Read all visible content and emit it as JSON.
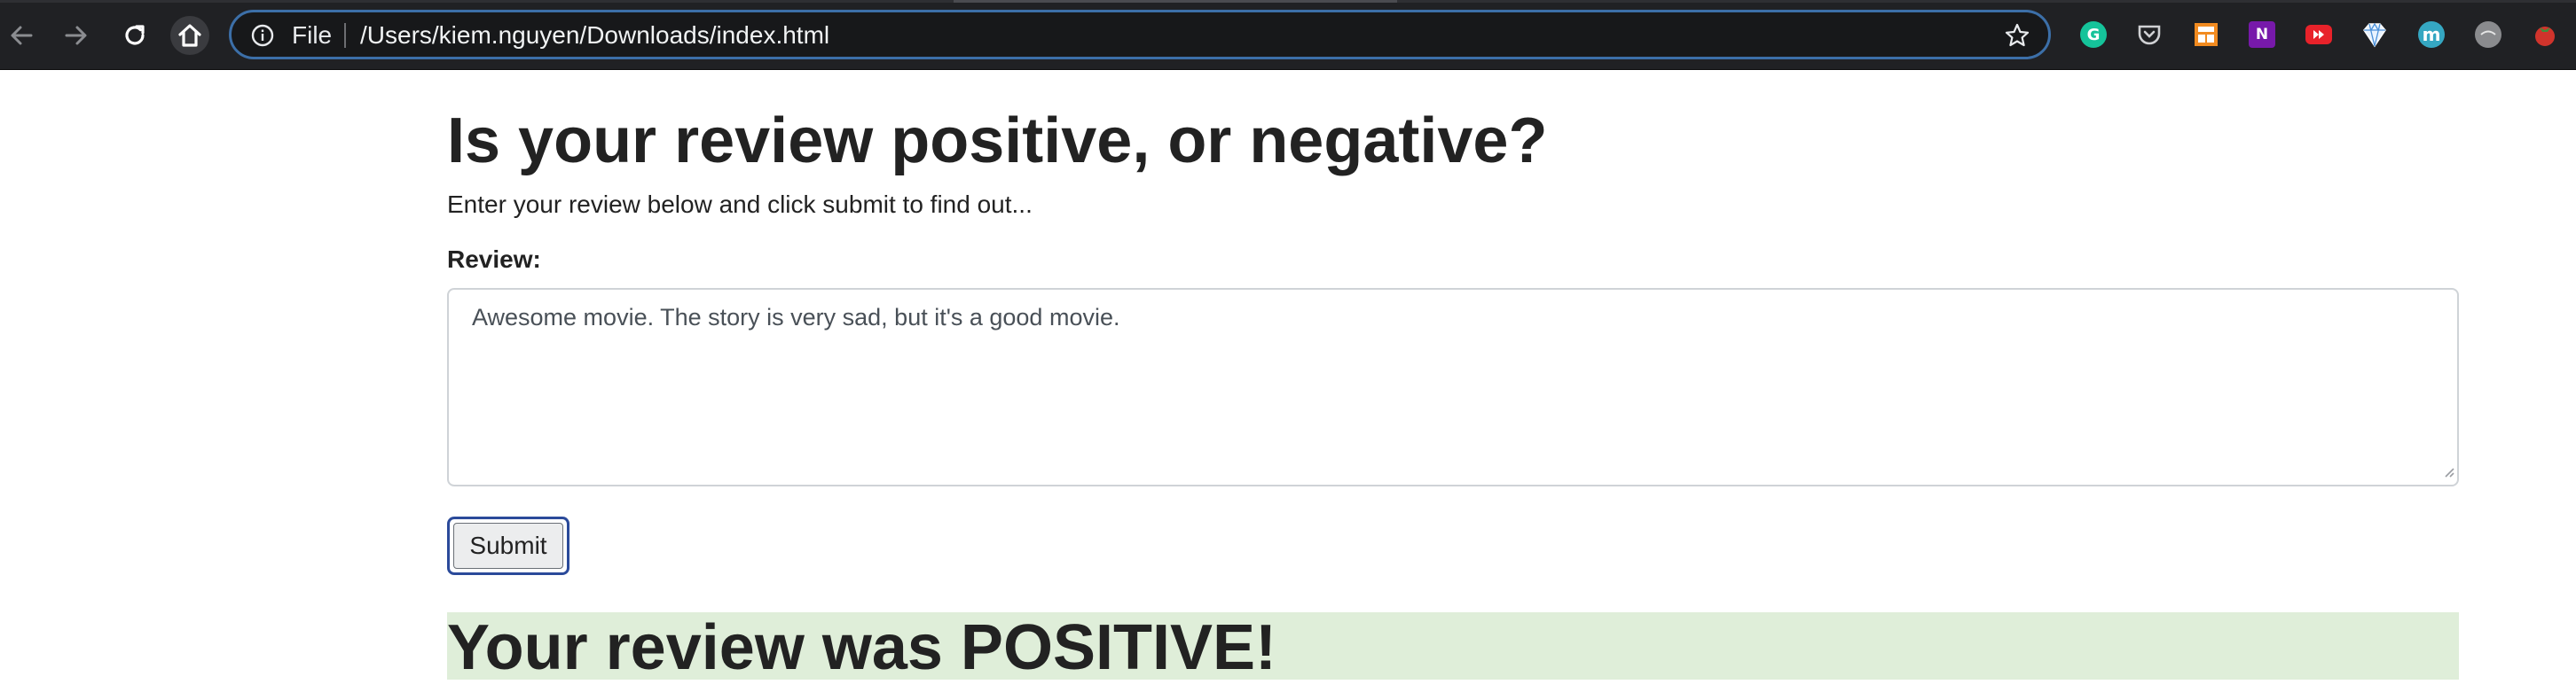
{
  "browser": {
    "address_scheme": "File",
    "address_url": "/Users/kiem.nguyen/Downloads/index.html",
    "nav_icons": [
      "back-arrow-icon",
      "forward-arrow-icon",
      "reload-icon",
      "home-icon"
    ],
    "extensions": [
      {
        "name": "grammarly-extension-icon",
        "label": "G",
        "color": "#15c39a"
      },
      {
        "name": "pocket-extension-icon",
        "label": "",
        "color": "#ef4056"
      },
      {
        "name": "layout-extension-icon",
        "label": "",
        "color": "#f28b20"
      },
      {
        "name": "onenote-extension-icon",
        "label": "N",
        "color": "#7719aa"
      },
      {
        "name": "video-extension-icon",
        "label": "",
        "color": "#e8222a"
      },
      {
        "name": "diamond-extension-icon",
        "label": "",
        "color": "#d9ecff"
      },
      {
        "name": "m-extension-icon",
        "label": "m",
        "color": "#35a7c2"
      },
      {
        "name": "grey-circle-extension-icon",
        "label": "",
        "color": "#8a8b8e"
      },
      {
        "name": "tomato-extension-icon",
        "label": "",
        "color": "#d0342c"
      }
    ]
  },
  "page": {
    "title": "Is your review positive, or negative?",
    "subtitle": "Enter your review below and click submit to find out...",
    "review_label": "Review:",
    "review_value": "Awesome movie. The story is very sad, but it's a good movie.",
    "submit_label": "Submit",
    "result_text": "Your review was POSITIVE!",
    "result_bg_color": "#dfeed9"
  }
}
